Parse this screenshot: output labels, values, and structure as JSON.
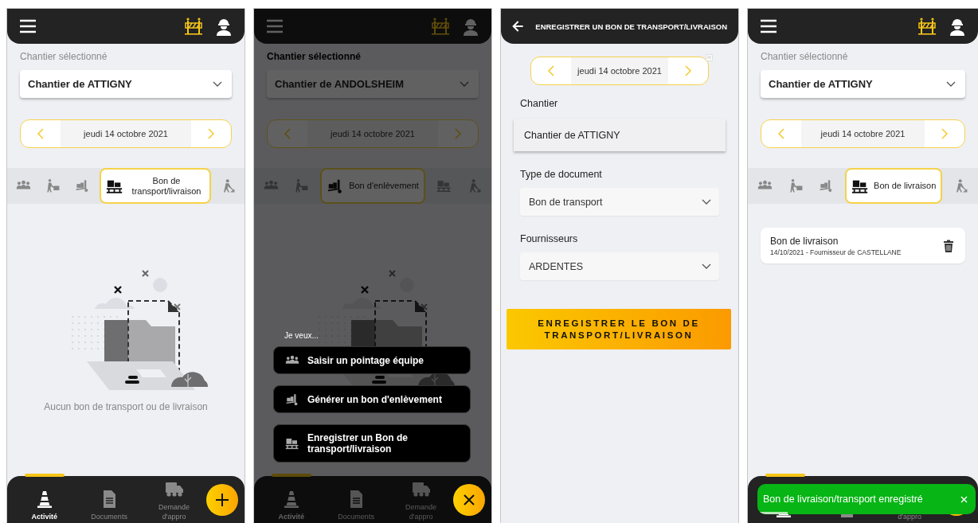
{
  "screens": [
    {
      "kind": "home",
      "header": {
        "kind": "main"
      },
      "site_label": "Chantier sélectionné",
      "site": "Chantier de ATTIGNY",
      "date": "jeudi 14 octobre 2021",
      "tabs": [
        {
          "kind": "team",
          "selected": false
        },
        {
          "kind": "mover",
          "selected": false
        },
        {
          "kind": "pickup",
          "selected": false
        },
        {
          "kind": "pallet",
          "selected": true,
          "label": "Bon de transport/livraison"
        },
        {
          "kind": "digger",
          "selected": false
        }
      ],
      "empty_text": "Aucun bon de transport ou de livraison",
      "nav": [
        {
          "kind": "activity",
          "label": "Activité",
          "selected": true
        },
        {
          "kind": "documents",
          "label": "Documents",
          "selected": false
        },
        {
          "kind": "supply",
          "label": "Demande d'appro",
          "selected": false
        }
      ],
      "fab": {
        "kind": "add"
      }
    },
    {
      "kind": "home",
      "header": {
        "kind": "main"
      },
      "dimmed": true,
      "site_label": "Chantier sélectionné",
      "site": "Chantier de ANDOLSHEIM",
      "date": "jeudi 14 octobre 2021",
      "tabs": [
        {
          "kind": "team",
          "selected": false
        },
        {
          "kind": "mover",
          "selected": false
        },
        {
          "kind": "pickup",
          "selected": true,
          "label": "Bon d'enlèvement"
        },
        {
          "kind": "pallet",
          "selected": false
        },
        {
          "kind": "digger",
          "selected": false
        }
      ],
      "menu": {
        "title": "Je veux...",
        "items": [
          {
            "kind": "team",
            "label": "Saisir un pointage équipe"
          },
          {
            "kind": "pickup",
            "label": "Générer un bon d'enlèvement"
          },
          {
            "kind": "pallet",
            "label": "Enregistrer un Bon de transport/livraison"
          }
        ]
      },
      "nav": [
        {
          "kind": "activity",
          "label": "Activité",
          "selected": true
        },
        {
          "kind": "documents",
          "label": "Documents",
          "selected": false
        },
        {
          "kind": "supply",
          "label": "Demande d'appro",
          "selected": false
        }
      ],
      "fab": {
        "kind": "close"
      }
    },
    {
      "kind": "form",
      "header": {
        "kind": "back",
        "title": "ENREGISTRER UN BON DE TRANSPORT/LIVRAISON"
      },
      "date": "jeudi 14 octobre 2021",
      "fields": [
        {
          "kind": "text",
          "label": "Chantier",
          "value": "Chantier de ATTIGNY"
        },
        {
          "kind": "select",
          "label": "Type de document",
          "value": "Bon de transport"
        },
        {
          "kind": "select",
          "label": "Fournisseurs",
          "value": "ARDENTES"
        }
      ],
      "submit": "ENREGISTRER LE BON DE TRANSPORT/LIVRAISON"
    },
    {
      "kind": "home",
      "header": {
        "kind": "main"
      },
      "site_label": "Chantier sélectionné",
      "site": "Chantier de ATTIGNY",
      "date": "jeudi 14 octobre 2021",
      "tabs": [
        {
          "kind": "team",
          "selected": false
        },
        {
          "kind": "mover",
          "selected": false
        },
        {
          "kind": "pickup",
          "selected": false
        },
        {
          "kind": "pallet",
          "selected": true,
          "label": "Bon de livraison"
        },
        {
          "kind": "digger",
          "selected": false
        }
      ],
      "records": [
        {
          "title": "Bon de livraison",
          "subtitle": "14/10/2021 - Fournisseur de CASTELLANE"
        }
      ],
      "nav": [
        {
          "kind": "activity",
          "selected": true
        },
        {
          "kind": "documents",
          "selected": false
        },
        {
          "kind": "supply",
          "label": "d'appro",
          "selected": false
        }
      ],
      "fab": {
        "kind": "add"
      },
      "toast": {
        "message": "Bon de livraison/transport enregistré",
        "level": 0.13
      }
    }
  ]
}
